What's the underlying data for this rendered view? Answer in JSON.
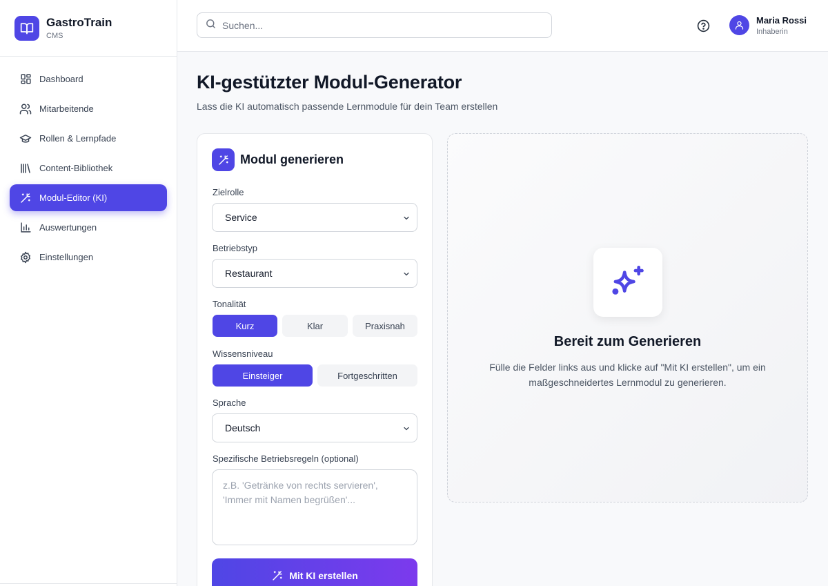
{
  "brand": {
    "name": "GastroTrain",
    "sub": "CMS"
  },
  "nav": {
    "items": [
      {
        "label": "Dashboard",
        "icon": "dashboard-icon"
      },
      {
        "label": "Mitarbeitende",
        "icon": "users-icon"
      },
      {
        "label": "Rollen & Lernpfade",
        "icon": "graduation-cap-icon"
      },
      {
        "label": "Content-Bibliothek",
        "icon": "library-icon"
      },
      {
        "label": "Modul-Editor (KI)",
        "icon": "magic-wand-icon",
        "active": true
      },
      {
        "label": "Auswertungen",
        "icon": "bar-chart-icon"
      },
      {
        "label": "Einstellungen",
        "icon": "gear-icon"
      }
    ]
  },
  "header": {
    "search_placeholder": "Suchen...",
    "user_name": "Maria Rossi",
    "user_role": "Inhaberin"
  },
  "page": {
    "title": "KI-gestützter Modul-Generator",
    "subtitle": "Lass die KI automatisch passende Lernmodule für dein Team erstellen"
  },
  "form": {
    "title": "Modul generieren",
    "zielrolle_label": "Zielrolle",
    "zielrolle_value": "Service",
    "betriebstyp_label": "Betriebstyp",
    "betriebstyp_value": "Restaurant",
    "tonalitaet_label": "Tonalität",
    "tonalitaet_options": [
      "Kurz",
      "Klar",
      "Praxisnah"
    ],
    "wissensniveau_label": "Wissensniveau",
    "wissensniveau_options": [
      "Einsteiger",
      "Fortgeschritten"
    ],
    "sprache_label": "Sprache",
    "sprache_value": "Deutsch",
    "regeln_label": "Spezifische Betriebsregeln (optional)",
    "regeln_placeholder": "z.B. 'Getränke von rechts servieren', 'Immer mit Namen begrüßen'...",
    "submit_label": "Mit KI erstellen"
  },
  "preview": {
    "title": "Bereit zum Generieren",
    "text": "Fülle die Felder links aus und klicke auf \"Mit KI erstellen\", um ein maßgeschneidertes Lernmodul zu generieren."
  },
  "colors": {
    "accent": "#4f46e5",
    "accent_end": "#7c3aed"
  }
}
